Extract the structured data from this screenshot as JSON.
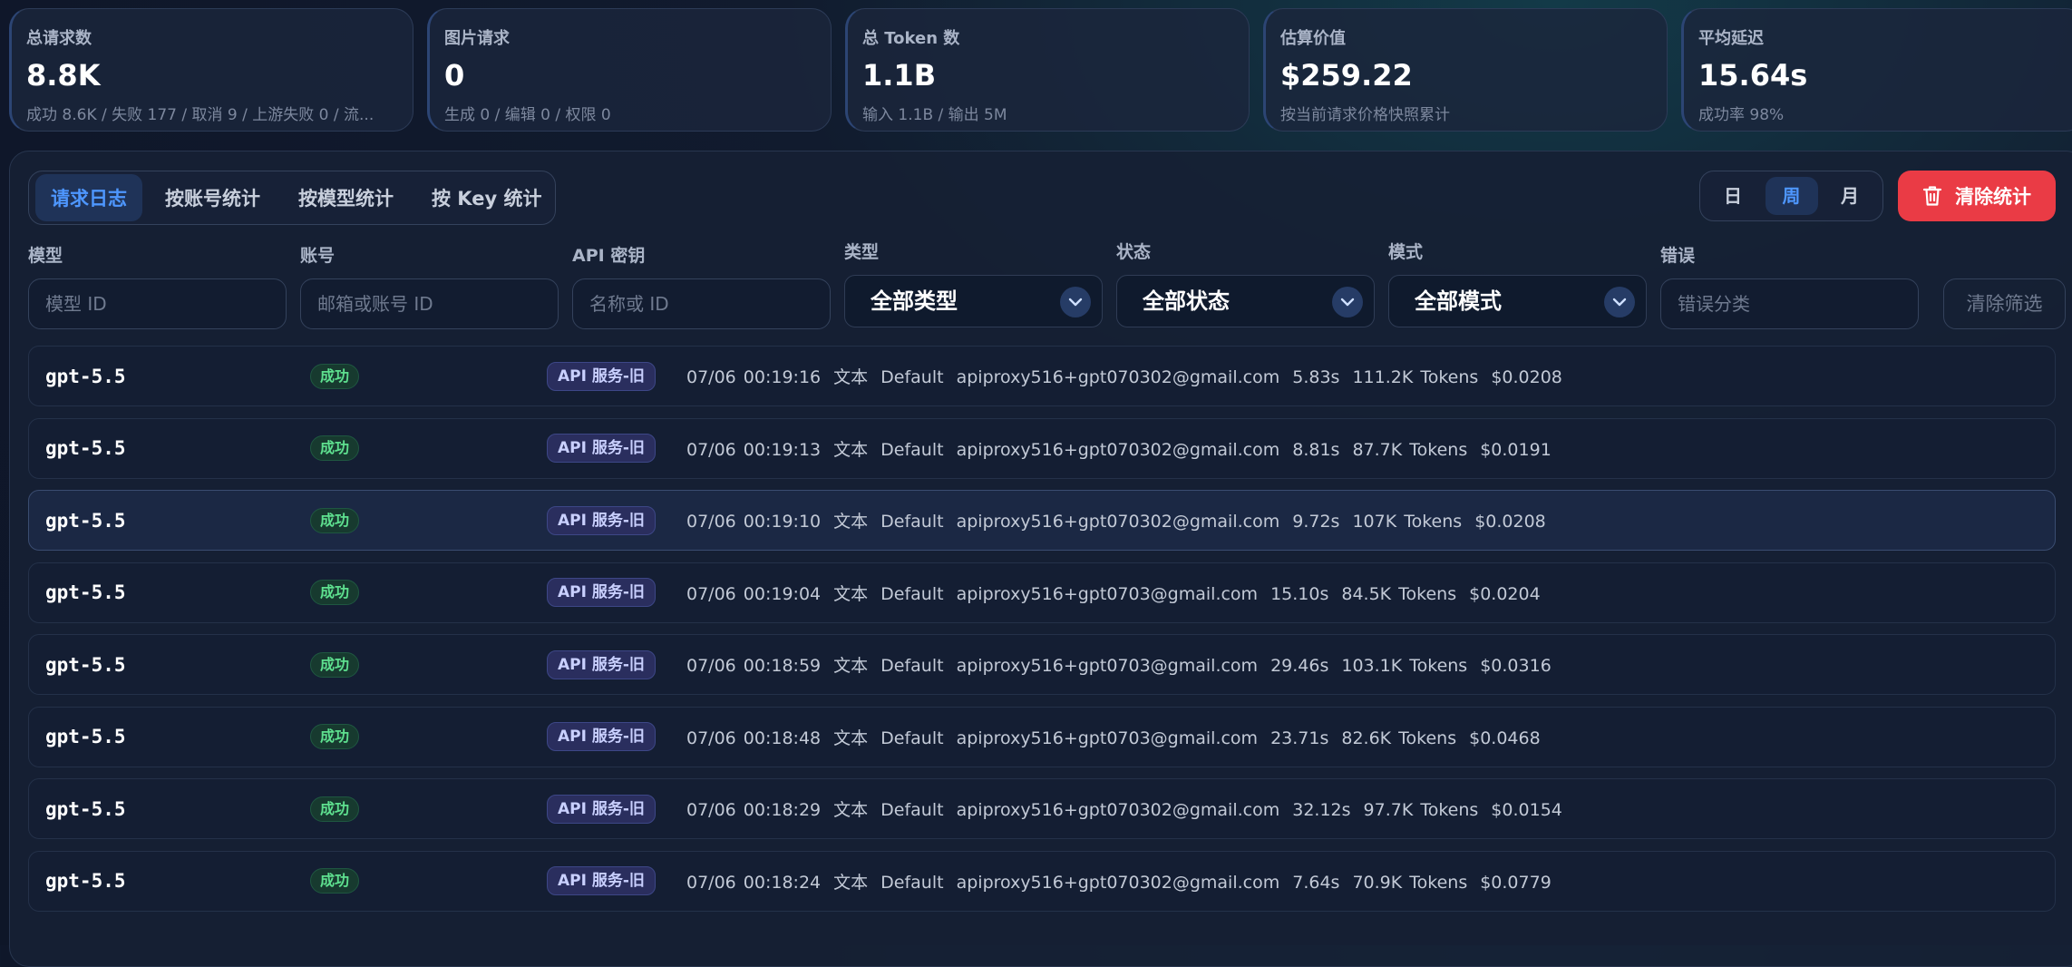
{
  "stats": [
    {
      "label": "总请求数",
      "value": "8.8K",
      "sub": "成功 8.6K / 失败 177 / 取消 9 / 上游失败 0 / 流..."
    },
    {
      "label": "图片请求",
      "value": "0",
      "sub": "生成 0 / 编辑 0 / 权限 0"
    },
    {
      "label": "总 Token 数",
      "value": "1.1B",
      "sub": "输入 1.1B / 输出 5M"
    },
    {
      "label": "估算价值",
      "value": "$259.22",
      "sub": "按当前请求价格快照累计"
    },
    {
      "label": "平均延迟",
      "value": "15.64s",
      "sub": "成功率 98%"
    }
  ],
  "tabs": [
    "请求日志",
    "按账号统计",
    "按模型统计",
    "按 Key 统计"
  ],
  "periods": [
    "日",
    "周",
    "月"
  ],
  "clear_label": "清除统计",
  "filters": {
    "model": {
      "label": "模型",
      "placeholder": "模型 ID"
    },
    "account": {
      "label": "账号",
      "placeholder": "邮箱或账号 ID"
    },
    "key": {
      "label": "API 密钥",
      "placeholder": "名称或 ID"
    },
    "type": {
      "label": "类型",
      "value": "全部类型"
    },
    "status": {
      "label": "状态",
      "value": "全部状态"
    },
    "mode": {
      "label": "模式",
      "value": "全部模式"
    },
    "error": {
      "label": "错误",
      "placeholder": "错误分类"
    },
    "reset_label": "清除筛选"
  },
  "rows": [
    {
      "model": "gpt-5.5",
      "status": "成功",
      "source": "API 服务-旧",
      "time": "07/06 00:19:16",
      "kind": "文本",
      "mode": "Default",
      "account": "apiproxy516+gpt070302@gmail.com",
      "latency": "5.83s",
      "tokens": "111.2K Tokens",
      "cost": "$0.0208"
    },
    {
      "model": "gpt-5.5",
      "status": "成功",
      "source": "API 服务-旧",
      "time": "07/06 00:19:13",
      "kind": "文本",
      "mode": "Default",
      "account": "apiproxy516+gpt070302@gmail.com",
      "latency": "8.81s",
      "tokens": "87.7K Tokens",
      "cost": "$0.0191"
    },
    {
      "model": "gpt-5.5",
      "status": "成功",
      "source": "API 服务-旧",
      "time": "07/06 00:19:10",
      "kind": "文本",
      "mode": "Default",
      "account": "apiproxy516+gpt070302@gmail.com",
      "latency": "9.72s",
      "tokens": "107K Tokens",
      "cost": "$0.0208"
    },
    {
      "model": "gpt-5.5",
      "status": "成功",
      "source": "API 服务-旧",
      "time": "07/06 00:19:04",
      "kind": "文本",
      "mode": "Default",
      "account": "apiproxy516+gpt0703@gmail.com",
      "latency": "15.10s",
      "tokens": "84.5K Tokens",
      "cost": "$0.0204"
    },
    {
      "model": "gpt-5.5",
      "status": "成功",
      "source": "API 服务-旧",
      "time": "07/06 00:18:59",
      "kind": "文本",
      "mode": "Default",
      "account": "apiproxy516+gpt0703@gmail.com",
      "latency": "29.46s",
      "tokens": "103.1K Tokens",
      "cost": "$0.0316"
    },
    {
      "model": "gpt-5.5",
      "status": "成功",
      "source": "API 服务-旧",
      "time": "07/06 00:18:48",
      "kind": "文本",
      "mode": "Default",
      "account": "apiproxy516+gpt0703@gmail.com",
      "latency": "23.71s",
      "tokens": "82.6K Tokens",
      "cost": "$0.0468"
    },
    {
      "model": "gpt-5.5",
      "status": "成功",
      "source": "API 服务-旧",
      "time": "07/06 00:18:29",
      "kind": "文本",
      "mode": "Default",
      "account": "apiproxy516+gpt070302@gmail.com",
      "latency": "32.12s",
      "tokens": "97.7K Tokens",
      "cost": "$0.0154"
    },
    {
      "model": "gpt-5.5",
      "status": "成功",
      "source": "API 服务-旧",
      "time": "07/06 00:18:24",
      "kind": "文本",
      "mode": "Default",
      "account": "apiproxy516+gpt070302@gmail.com",
      "latency": "7.64s",
      "tokens": "70.9K Tokens",
      "cost": "$0.0779"
    }
  ],
  "colors": {
    "accent": "#4e97ff",
    "danger": "#ea3b45",
    "success": "#5ee08f"
  }
}
